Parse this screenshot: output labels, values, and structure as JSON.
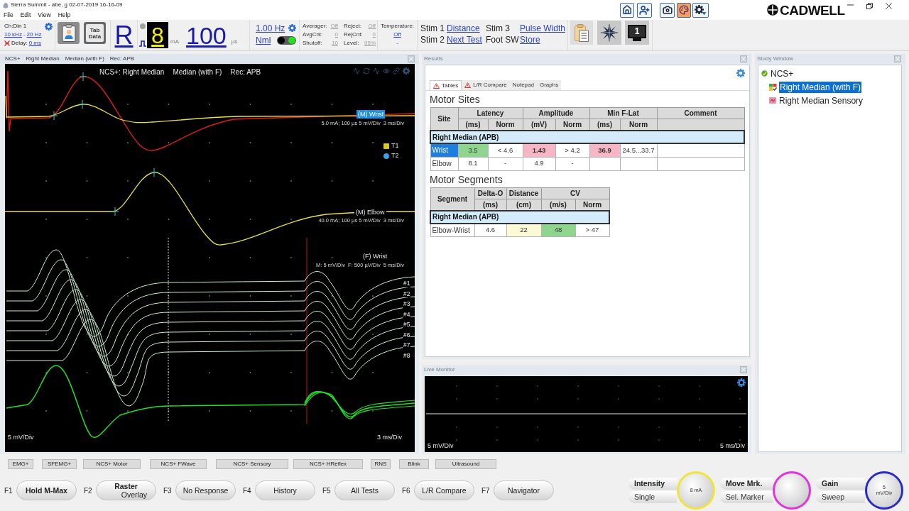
{
  "window": {
    "title": "Sierra Summit - abe, g 02-07-2019 16-16-09",
    "brand": "CADWELL"
  },
  "menu": [
    "File",
    "Edit",
    "View",
    "Help"
  ],
  "toolbar": {
    "channel": "Ch:Din 1",
    "filter_high": "10 kHz",
    "filter_sep": "-",
    "filter_low": "20 Hz",
    "delay_label": "Delay:",
    "delay_value": "0 ms",
    "tab_data": "Tab Data",
    "side": "R",
    "intensity": "8",
    "intensity_unit": "mA",
    "duration": "100",
    "duration_unit": "µs",
    "rate": "1.00 Hz",
    "mode": "Nml",
    "stim_on": true,
    "averager": [
      {
        "label": "Averager:",
        "value": "Off"
      },
      {
        "label": "AvgCnt:",
        "value": "0"
      },
      {
        "label": "Shutoff:",
        "value": "10"
      }
    ],
    "reject": [
      {
        "label": "Reject:",
        "value": "Off"
      },
      {
        "label": "RejCnt:",
        "value": "0"
      },
      {
        "label": "Level:",
        "value": "95%"
      }
    ],
    "temperature": {
      "label": "Temperature:",
      "value": "Off",
      "reading": "-"
    },
    "stim_grid": [
      {
        "text": "Stim 1",
        "kind": "label"
      },
      {
        "text": "Distance",
        "kind": "link"
      },
      {
        "text": "Stim 3",
        "kind": "label"
      },
      {
        "text": "Pulse Width",
        "kind": "link"
      },
      {
        "text": "Stim 2",
        "kind": "label"
      },
      {
        "text": "Next Test",
        "kind": "link"
      },
      {
        "text": "Foot SW",
        "kind": "label"
      },
      {
        "text": "Store",
        "kind": "link"
      }
    ],
    "monitor_number": "1"
  },
  "waveform_panel": {
    "header": [
      "NCS+",
      "Right Median",
      "Median (with F)",
      "Rec: APB"
    ],
    "plot_title": [
      "NCS+: Right Median",
      "Median (with F)",
      "Rec: APB"
    ],
    "traces": [
      {
        "label": "(M) Wrist",
        "selected": true,
        "settings": "5.0 mA; 100 µs 5 mV/Div  3 ms/Div"
      },
      {
        "label": "(M) Elbow",
        "selected": false,
        "settings": "40.0 mA; 100 µs 5 mV/Div  3 ms/Div"
      },
      {
        "label": "(F) Wrist",
        "selected": false,
        "settings": "M: 5 mV/Div  F: 500 µV/Div  5 ms/Div"
      }
    ],
    "markers": [
      "T1",
      "T2"
    ],
    "raster_numbers": [
      "#1",
      "#2",
      "#3",
      "#4",
      "#5",
      "#6",
      "#7",
      "#8"
    ],
    "gain": "5 mV/Div",
    "sweep": "3 ms/Div"
  },
  "results": {
    "title": "Results",
    "tabs": [
      {
        "label": "Tables",
        "warning": true,
        "selected": true
      },
      {
        "label": "L/R Compare",
        "warning": true,
        "selected": false
      },
      {
        "label": "Notepad",
        "warning": false,
        "selected": false
      },
      {
        "label": "Graphs",
        "warning": false,
        "selected": false
      }
    ],
    "motor_sites": {
      "title": "Motor Sites",
      "columns": [
        {
          "label": "Site"
        },
        {
          "label": "Latency",
          "colspan": 2,
          "units": [
            "(ms)",
            "Norm"
          ]
        },
        {
          "label": "Amplitude",
          "colspan": 2,
          "units": [
            "(mV)",
            "Norm"
          ]
        },
        {
          "label": "Min F-Lat",
          "colspan": 2,
          "units": [
            "(ms)",
            "Norm"
          ]
        },
        {
          "label": "Comment"
        }
      ],
      "group": "Right Median (APB)",
      "rows": [
        {
          "selected": true,
          "cells": [
            {
              "text": "Wrist"
            },
            {
              "text": "3.5",
              "color": "#8ed68e",
              "abnormal": false
            },
            {
              "text": "< 4.6",
              "color": "#ffffff",
              "abnormal": false
            },
            {
              "text": "1.43",
              "color": "#f6b6c6",
              "abnormal": true
            },
            {
              "text": "> 4.2",
              "color": "#ffffff",
              "abnormal": false
            },
            {
              "text": "36.9",
              "color": "#f6b6c6",
              "abnormal": true
            },
            {
              "text": "24.5...33.7",
              "color": "#ffffff",
              "abnormal": false
            }
          ]
        },
        {
          "selected": false,
          "cells": [
            {
              "text": "Elbow"
            },
            {
              "text": "8.1",
              "color": "#ffffff",
              "abnormal": false
            },
            {
              "text": "-",
              "color": "#ffffff",
              "abnormal": false
            },
            {
              "text": "4.9",
              "color": "#ffffff",
              "abnormal": false
            },
            {
              "text": "-",
              "color": "#ffffff",
              "abnormal": false
            }
          ]
        }
      ]
    },
    "motor_segments": {
      "title": "Motor Segments",
      "columns": [
        {
          "label": "Segment"
        },
        {
          "label": "Delta-O",
          "units": [
            "(ms)"
          ]
        },
        {
          "label": "Distance",
          "units": [
            "(cm)"
          ]
        },
        {
          "label": "CV",
          "colspan": 2,
          "units": [
            "(m/s)",
            "Norm"
          ]
        }
      ],
      "group": "Right Median (APB)",
      "rows": [
        {
          "selected": false,
          "cells": [
            {
              "text": "Elbow-Wrist"
            },
            {
              "text": "4.6",
              "color": "#ffffff",
              "abnormal": false
            },
            {
              "text": "22",
              "color": "#fcfad6",
              "abnormal": false
            },
            {
              "text": "48",
              "color": "#8ed68e",
              "abnormal": false
            },
            {
              "text": "> 47",
              "color": "#ffffff",
              "abnormal": false
            }
          ]
        }
      ]
    }
  },
  "live_monitor": {
    "title": "Live Monitor",
    "gain": "5 mV/Div",
    "sweep": "5 ms/Div"
  },
  "study_window": {
    "title": "Study Window",
    "tree": [
      {
        "label": "NCS+",
        "selected": false,
        "children": [
          {
            "label": "Right Median (with F)",
            "selected": true
          },
          {
            "label": "Right Median Sensory",
            "selected": false
          }
        ]
      }
    ]
  },
  "test_tabs": [
    "EMG+",
    "SFEMG+",
    "NCS+ Motor",
    "NCS+ FWave",
    "NCS+ Sensory",
    "NCS+ HReflex",
    "RNS",
    "Blink",
    "Ultrasound"
  ],
  "function_keys": [
    {
      "key": "F1",
      "label": "Hold M-Max",
      "emphasized": true
    },
    {
      "key": "F2",
      "label": "Raster",
      "detail": "Overlay",
      "emphasized": true
    },
    {
      "key": "F3",
      "label": "No Response",
      "emphasized": false
    },
    {
      "key": "F4",
      "label": "History",
      "emphasized": false
    },
    {
      "key": "F5",
      "label": "All Tests",
      "emphasized": false
    },
    {
      "key": "F6",
      "label": "L/R Compare",
      "emphasized": false
    },
    {
      "key": "F7",
      "label": "Navigator",
      "emphasized": false
    }
  ],
  "knobs": [
    {
      "label": "Intensity",
      "mode": "Single",
      "reading": "8 mA",
      "color": "#f0e43c"
    },
    {
      "label": "Move Mrk.",
      "mode": "Sel. Marker",
      "color": "#e034dc"
    },
    {
      "label": "Gain",
      "mode": "Sweep",
      "reading": "5 mV/Div",
      "color": "#2a2ac8"
    }
  ]
}
